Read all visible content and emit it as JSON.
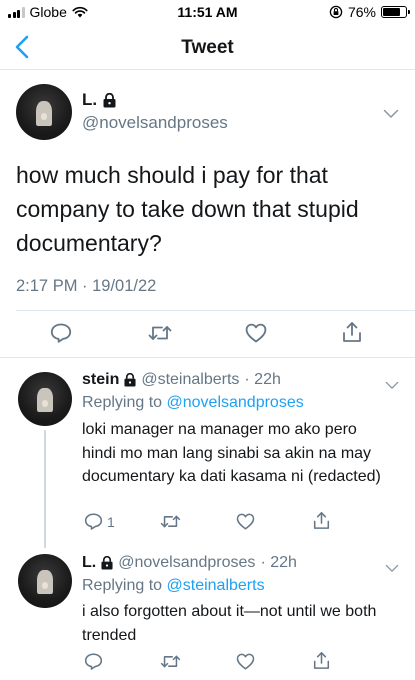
{
  "status_bar": {
    "carrier": "Globe",
    "time": "11:51 AM",
    "battery": "76%",
    "battery_level": 0.76
  },
  "nav": {
    "title": "Tweet",
    "back_icon": "chevron-left-icon"
  },
  "main_tweet": {
    "name": "L.",
    "handle": "@novelsandproses",
    "text": "how much should i pay for that company to take down that stupid documentary?",
    "timestamp": "2:17 PM · 19/01/22"
  },
  "replies": [
    {
      "name": "stein",
      "handle": "@steinalberts",
      "time": "· 22h",
      "replying_prefix": "Replying to",
      "replying_to": "@novelsandproses",
      "text": "loki manager na manager mo ako pero hindi mo man lang sinabi sa akin na may documentary ka dati kasama ni (redacted)",
      "reply_count": "1"
    },
    {
      "name": "L.",
      "handle": "@novelsandproses",
      "time": "· 22h",
      "replying_prefix": "Replying to",
      "replying_to": "@steinalberts",
      "text": "i also forgotten about it—not until we both trended",
      "reply_count": ""
    }
  ],
  "colors": {
    "accent": "#1da1f2",
    "secondary_text": "#657786",
    "divider": "#e1e8ed"
  }
}
